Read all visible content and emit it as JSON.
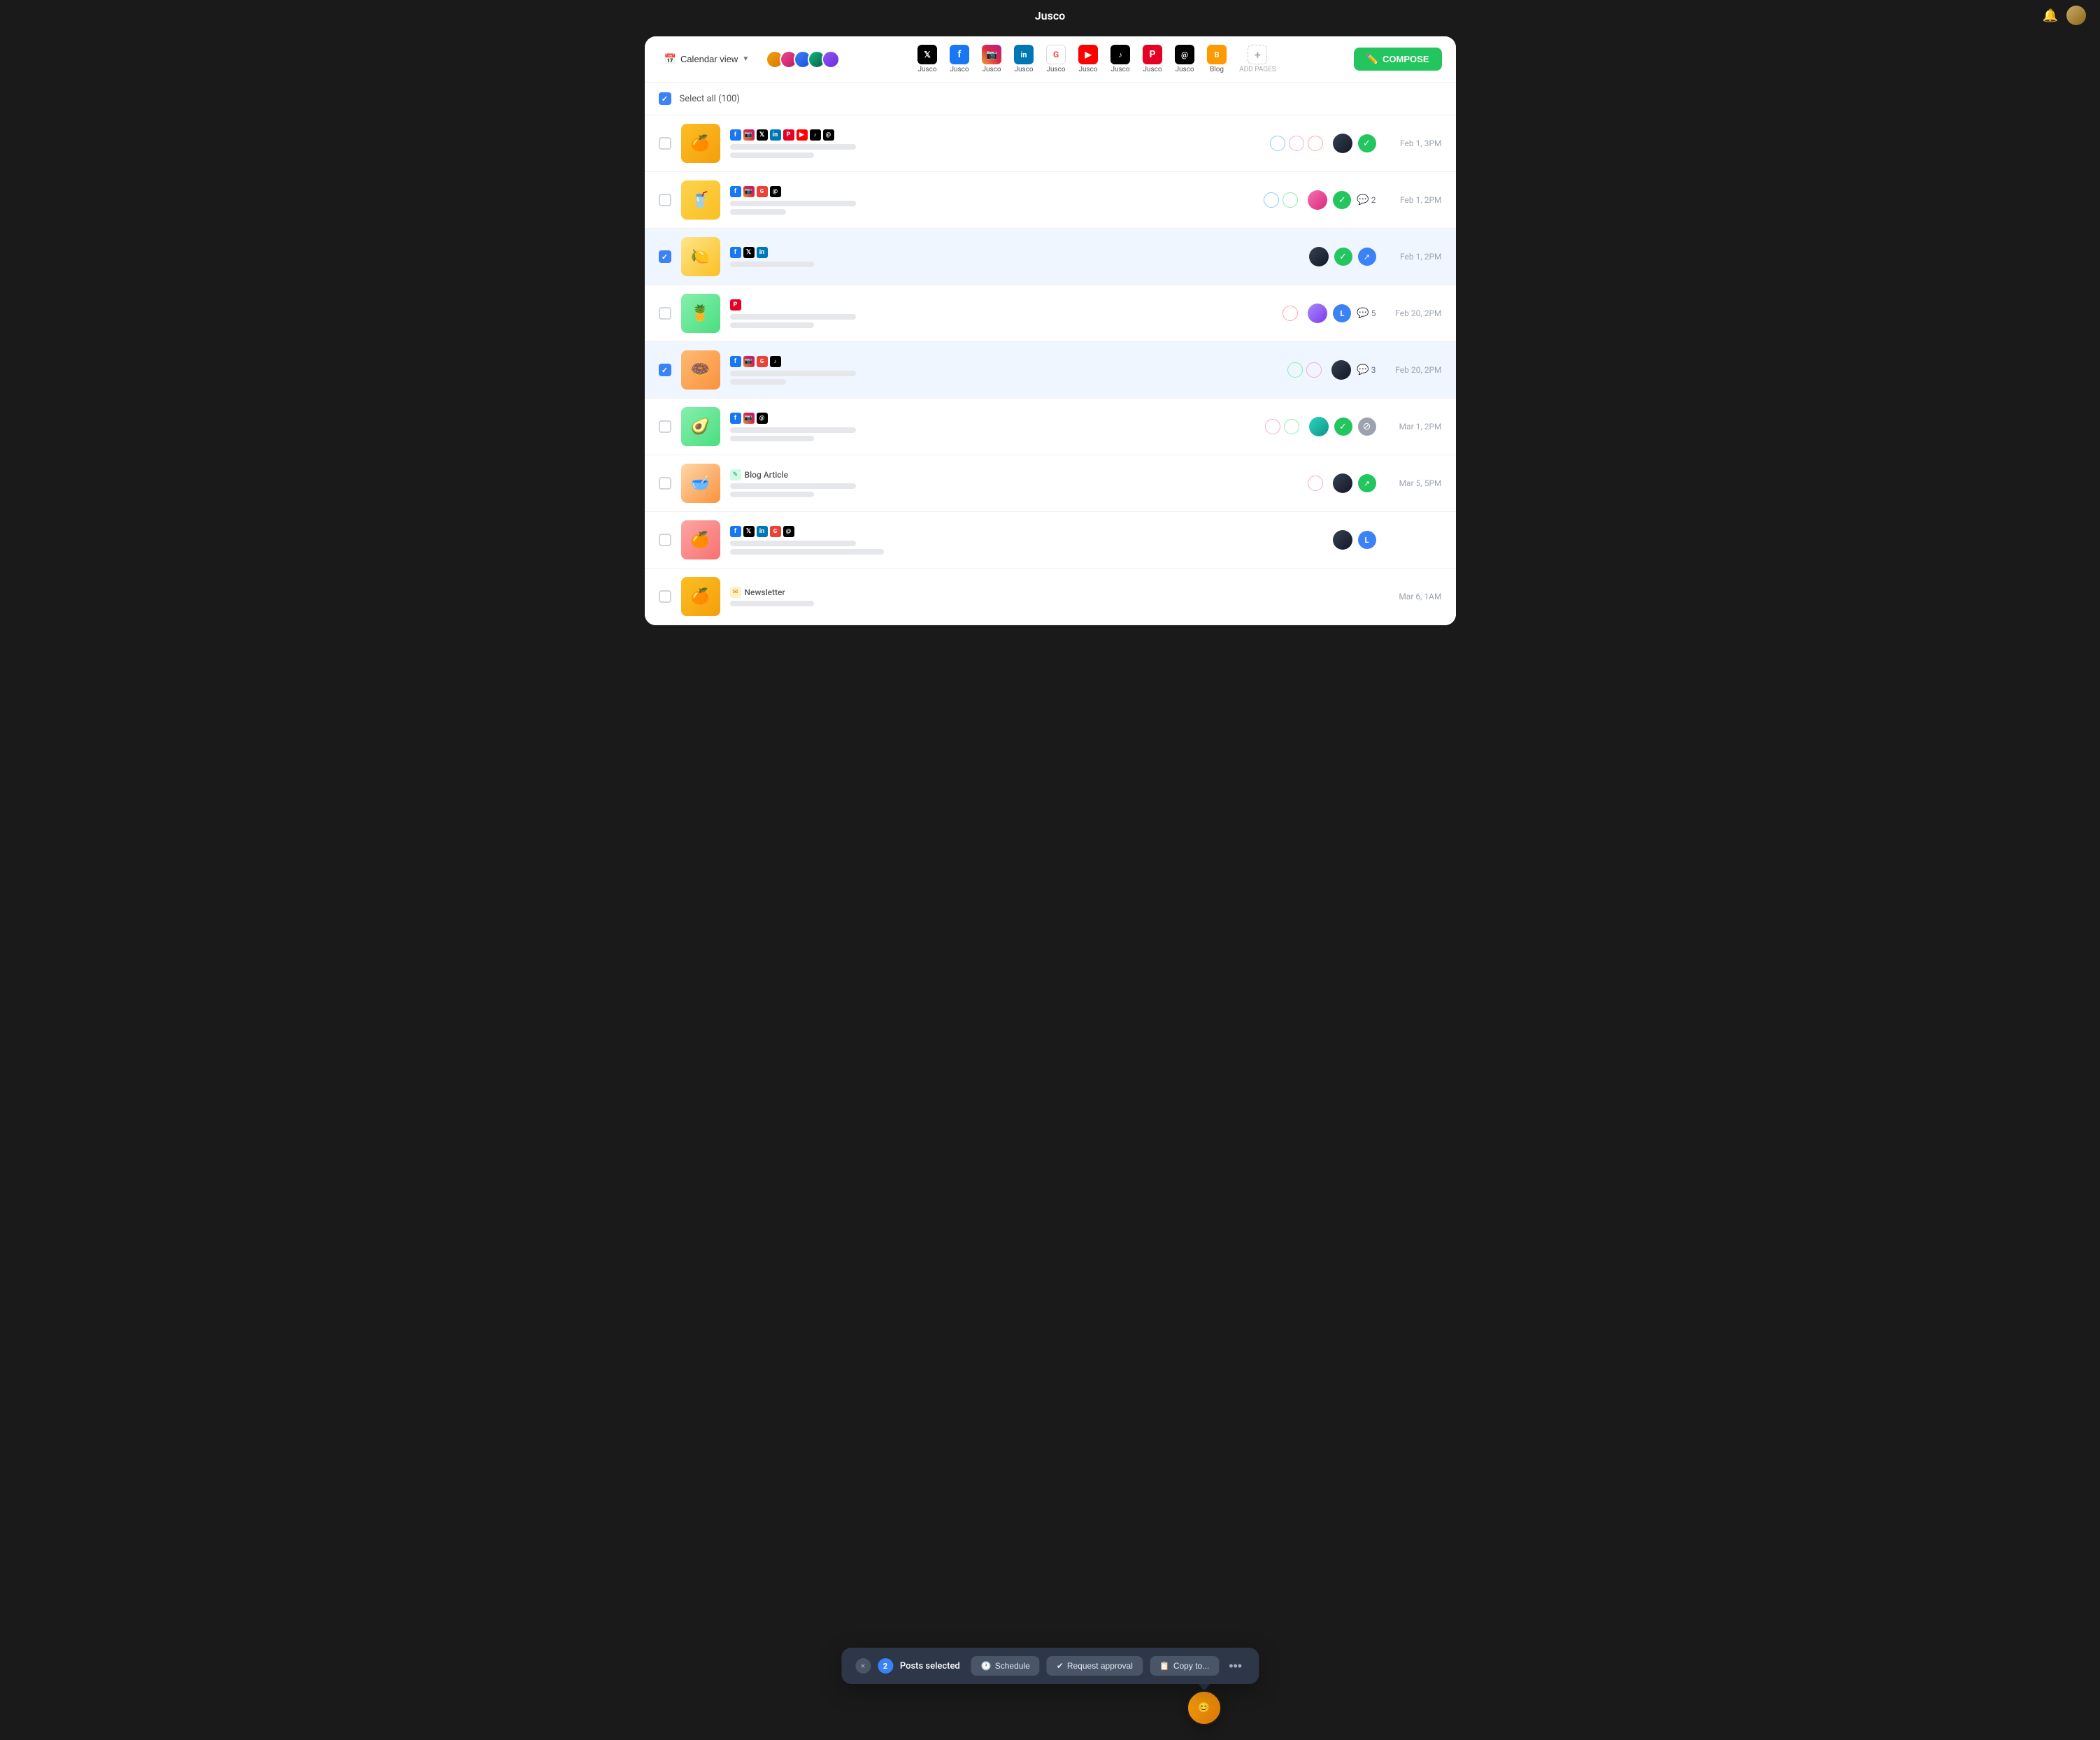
{
  "app": {
    "title": "Jusco",
    "notification_icon": "🔔"
  },
  "header": {
    "calendar_view_label": "Calendar view",
    "compose_label": "COMPOSE",
    "add_pages_label": "ADD PAGES",
    "social_tabs": [
      {
        "id": "twitter",
        "label": "Jusco",
        "platform": "X"
      },
      {
        "id": "facebook",
        "label": "Jusco",
        "platform": "Facebook"
      },
      {
        "id": "instagram",
        "label": "Jusco",
        "platform": "Instagram"
      },
      {
        "id": "linkedin",
        "label": "Jusco",
        "platform": "LinkedIn"
      },
      {
        "id": "google",
        "label": "Jusco",
        "platform": "Google"
      },
      {
        "id": "youtube",
        "label": "Jusco",
        "platform": "YouTube"
      },
      {
        "id": "tiktok",
        "label": "Jusco",
        "platform": "TikTok"
      },
      {
        "id": "pinterest",
        "label": "Jusco",
        "platform": "Pinterest"
      },
      {
        "id": "threads",
        "label": "Jusco",
        "platform": "Threads"
      },
      {
        "id": "blog",
        "label": "Blog",
        "platform": "Blog"
      },
      {
        "id": "add",
        "label": "",
        "platform": "Add"
      }
    ]
  },
  "select_all": {
    "label": "Select all (100)",
    "checked": true
  },
  "posts": [
    {
      "id": 1,
      "selected": false,
      "thumb_class": "thumb-oranges",
      "thumb_emoji": "🍊",
      "social_icons": [
        "fb",
        "ig",
        "x",
        "li",
        "pi",
        "yt",
        "tk",
        "th"
      ],
      "tags": [
        {
          "label": "",
          "style": "tag-outline-blue"
        },
        {
          "label": "",
          "style": "tag-outline-pink"
        },
        {
          "label": "",
          "style": "tag-outline-red"
        }
      ],
      "avatar_class": "ua-dark",
      "status1": "sb-green",
      "status1_icon": "✓",
      "comment_count": null,
      "date": "Feb 1, 3PM"
    },
    {
      "id": 2,
      "selected": false,
      "thumb_class": "thumb-juice",
      "thumb_emoji": "🥤",
      "social_icons": [
        "fb",
        "ig",
        "gg",
        "th"
      ],
      "tags": [
        {
          "label": "",
          "style": "tag-outline-blue"
        },
        {
          "label": "",
          "style": "tag-outline-green"
        }
      ],
      "avatar_class": "ua-pink",
      "status1": "sb-green",
      "status1_icon": "✓",
      "comment_count": 2,
      "date": "Feb 1, 2PM"
    },
    {
      "id": 3,
      "selected": true,
      "thumb_class": "thumb-lemon",
      "thumb_emoji": "🍋",
      "social_icons": [
        "fb",
        "x",
        "li"
      ],
      "tags": [],
      "avatar_class": "ua-dark",
      "status1": "sb-green",
      "status1_icon": "✓",
      "status2": "sb-blue",
      "status2_icon": "↗",
      "comment_count": null,
      "date": "Feb 1, 2PM"
    },
    {
      "id": 4,
      "selected": false,
      "thumb_class": "thumb-pineapple",
      "thumb_emoji": "🍍",
      "social_icons": [
        "pi"
      ],
      "tags": [
        {
          "label": "",
          "style": "tag-outline-red"
        }
      ],
      "avatar_class": "ua-purple",
      "status1": "sb-blue",
      "status1_icon": "L",
      "comment_count": 5,
      "date": "Feb 20, 2PM"
    },
    {
      "id": 5,
      "selected": true,
      "thumb_class": "thumb-donuts",
      "thumb_emoji": "🍩",
      "social_icons": [
        "fb",
        "ig",
        "gg",
        "tk"
      ],
      "tags": [
        {
          "label": "",
          "style": "tag-outline-green"
        },
        {
          "label": "",
          "style": "tag-outline-pink"
        }
      ],
      "avatar_class": "ua-dark",
      "status1": null,
      "comment_count": 3,
      "date": "Feb 20, 2PM"
    },
    {
      "id": 6,
      "selected": false,
      "thumb_class": "thumb-avocado",
      "thumb_emoji": "🥑",
      "social_icons": [
        "fb",
        "ig",
        "th"
      ],
      "tags": [
        {
          "label": "",
          "style": "tag-outline-pink"
        },
        {
          "label": "",
          "style": "tag-outline-green"
        }
      ],
      "avatar_class": "ua-teal",
      "status1": "sb-green",
      "status1_icon": "✓",
      "status2_slash": true,
      "comment_count": null,
      "date": "Mar 1, 2PM"
    },
    {
      "id": 7,
      "selected": false,
      "thumb_class": "thumb-soup",
      "thumb_emoji": "🥣",
      "social_icons": [],
      "label": "Blog Article",
      "label_icon_class": "li-blog",
      "label_icon": "✎",
      "tags": [
        {
          "label": "",
          "style": "tag-outline-pink"
        }
      ],
      "avatar_class": "ua-dark",
      "status1": "sb-green",
      "status1_icon": "↗",
      "comment_count": null,
      "date": "Mar 5, 5PM"
    },
    {
      "id": 8,
      "selected": false,
      "thumb_class": "thumb-grapefruit",
      "thumb_emoji": "🍊",
      "social_icons": [
        "fb",
        "x",
        "li",
        "gg",
        "th"
      ],
      "tags": [],
      "avatar_class": "ua-dark",
      "status1": "sb-blue",
      "status1_icon": "L",
      "comment_count": null,
      "date": ""
    },
    {
      "id": 9,
      "selected": false,
      "thumb_class": "thumb-orange2",
      "thumb_emoji": "🍊",
      "social_icons": [],
      "label": "Newsletter",
      "label_icon_class": "li-newsletter",
      "label_icon": "✉",
      "tags": [],
      "avatar_class": null,
      "status1": null,
      "comment_count": null,
      "date": "Mar 6, 1AM"
    }
  ],
  "floating_bar": {
    "close_label": "×",
    "count": "2",
    "title": "Posts selected",
    "schedule_label": "Schedule",
    "request_approval_label": "Request approval",
    "copy_to_label": "Copy to...",
    "more_label": "•••"
  }
}
